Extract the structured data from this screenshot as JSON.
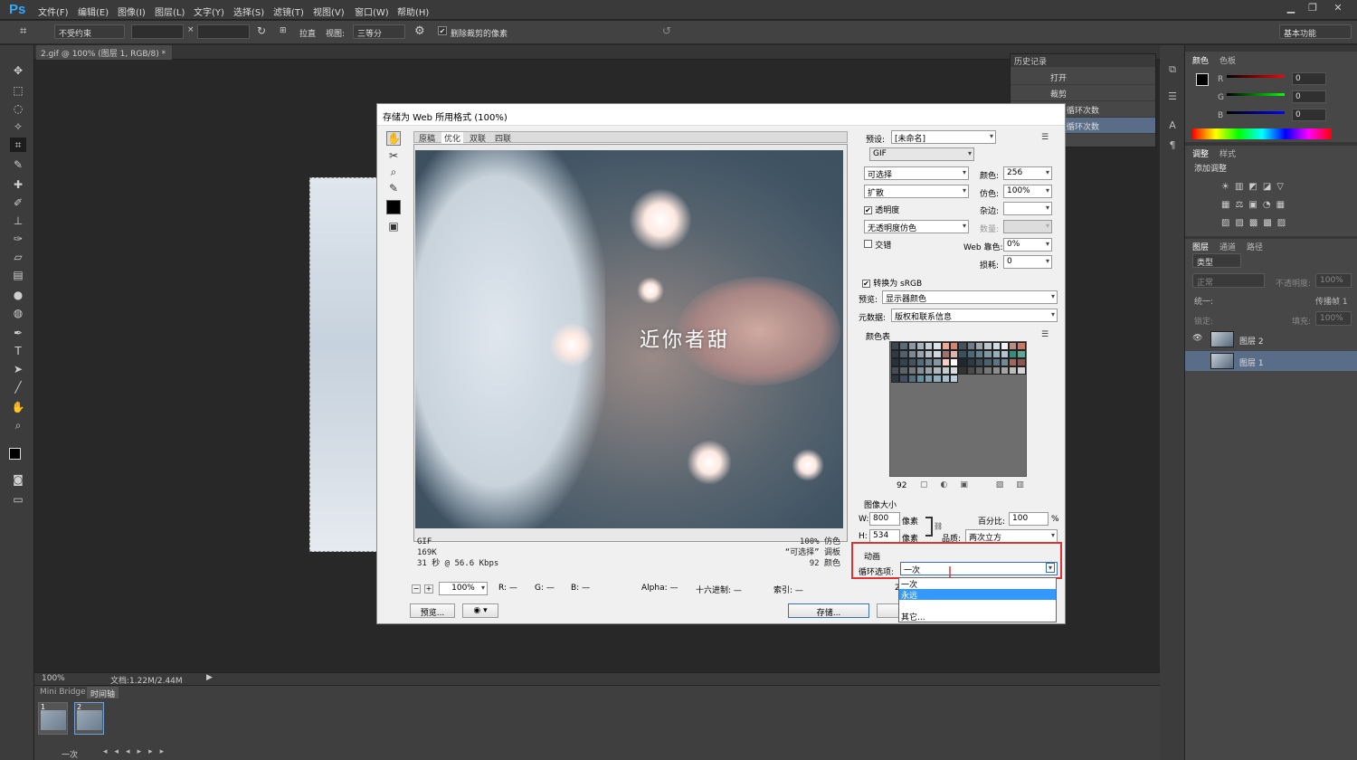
{
  "app": {
    "logo": "Ps"
  },
  "menu": [
    "文件(F)",
    "编辑(E)",
    "图像(I)",
    "图层(L)",
    "文字(Y)",
    "选择(S)",
    "滤镜(T)",
    "视图(V)",
    "窗口(W)",
    "帮助(H)"
  ],
  "options": {
    "ratio": "不受约束",
    "straighten": "拉直",
    "view_label": "视图:",
    "view_value": "三等分",
    "delete_cropped": "删除裁剪的像素",
    "workspace": "基本功能"
  },
  "doc_tab": "2.gif @ 100% (图层 1, RGB/8) *",
  "status": {
    "zoom": "100%",
    "doc_info": "文档:1.22M/2.44M"
  },
  "bottom": {
    "tab1": "Mini Bridge",
    "tab2": "时间轴",
    "loop": "一次",
    "frame1": "1",
    "frame2": "2"
  },
  "history": {
    "title": "历史记录",
    "items": [
      "打开",
      "裁剪",
      "设置循环次数",
      "设置循环次数"
    ]
  },
  "dialog": {
    "title": "存储为 Web 所用格式 (100%)",
    "tabs": [
      "原稿",
      "优化",
      "双联",
      "四联"
    ],
    "caption": "近你者甜",
    "info_left": [
      "GIF",
      "169K",
      "31 秒 @ 56.6 Kbps"
    ],
    "info_right": [
      "100% 仿色",
      "“可选择” 调板",
      "92 颜色"
    ],
    "zoom": "100%",
    "readout": {
      "r": "R: —",
      "g": "G: —",
      "b": "B: —",
      "alpha": "Alpha: —",
      "hex": "十六进制: —",
      "index": "索引: —"
    },
    "preview_btn": "预览...",
    "save_btn": "存储...",
    "preset_label": "预设:",
    "preset_value": "[未命名]",
    "format": "GIF",
    "reduction": "可选择",
    "dither_algo": "扩散",
    "transparency": "透明度",
    "trans_dither": "无透明度仿色",
    "interlaced": "交错",
    "colors_label": "颜色:",
    "colors_value": "256",
    "dither_label": "仿色:",
    "dither_value": "100%",
    "matte_label": "杂边:",
    "amount_label": "数量:",
    "websnap_label": "Web 靠色:",
    "websnap_value": "0%",
    "lossy_label": "损耗:",
    "lossy_value": "0",
    "srgb": "转换为 sRGB",
    "preview_label": "预览:",
    "preview_value": "显示器颜色",
    "metadata_label": "元数据:",
    "metadata_value": "版权和联系信息",
    "color_table": "颜色表",
    "palette_count": "92",
    "image_size": "图像大小",
    "w_label": "W:",
    "w_value": "800",
    "h_label": "H:",
    "h_value": "534",
    "px": "像素",
    "percent_label": "百分比:",
    "percent_value": "100",
    "percent_unit": "%",
    "quality_label": "品质:",
    "quality_value": "两次立方",
    "animation": "动画",
    "loop_label": "循环选项:",
    "loop_value": "一次",
    "loop_options": [
      "一次",
      "永远",
      "其它..."
    ],
    "frame_counter": "2"
  },
  "color_panel": {
    "tab1": "颜色",
    "tab2": "色板",
    "r": "R",
    "g": "G",
    "b": "B",
    "rv": "0",
    "gv": "0",
    "bv": "0"
  },
  "adjust_panel": {
    "tab1": "调整",
    "tab2": "样式",
    "title": "添加调整"
  },
  "layers_panel": {
    "tab1": "图层",
    "tab2": "通道",
    "tab3": "路径",
    "kind": "类型",
    "blend": "正常",
    "opacity_label": "不透明度:",
    "opacity_value": "100%",
    "unify": "统一:",
    "propagate": "传播帧 1",
    "lock": "锁定:",
    "fill_label": "填充:",
    "fill_value": "100%",
    "layers": [
      "图层 2",
      "图层 1"
    ]
  },
  "palette_colors": [
    "#3c4752",
    "#5d6a75",
    "#8b97a2",
    "#a7b3bd",
    "#c5d0d9",
    "#dbe3ea",
    "#e8a89a",
    "#d98270",
    "#46525c",
    "#6f7c88",
    "#9ba6af",
    "#bcc6ce",
    "#d3dbe2",
    "#eef2f5",
    "#b58e88",
    "#c87865",
    "#2f3a44",
    "#52606c",
    "#7b8893",
    "#98a3ad",
    "#b4bfc8",
    "#cfd8e0",
    "#9c7370",
    "#e2b3a8",
    "#39505f",
    "#4c6878",
    "#63808f",
    "#7e98a5",
    "#97aeb9",
    "#b2c4cd",
    "#3b8a7a",
    "#5fa596",
    "#26323c",
    "#344350",
    "#415462",
    "#566b79",
    "#6d8390",
    "#8398a4",
    "#f0d0c8",
    "#ffffff",
    "#1e2830",
    "#2a3a46",
    "#3a4e5c",
    "#4b6170",
    "#5d7584",
    "#728a98",
    "#a06860",
    "#8a5850",
    "#474d54",
    "#5c6269",
    "#71787f",
    "#868d94",
    "#9ba2a9",
    "#b0b7be",
    "#c4cbd1",
    "#d8dde2",
    "#333333",
    "#4a4a4a",
    "#606060",
    "#777777",
    "#8e8e8e",
    "#a5a5a5",
    "#bcbcbc",
    "#d3d3d3",
    "#2c3640",
    "#405060",
    "#547080",
    "#6890a0",
    "#7ca0b0",
    "#90b0c0",
    "#a4c0d0",
    "#b8d0e0"
  ]
}
